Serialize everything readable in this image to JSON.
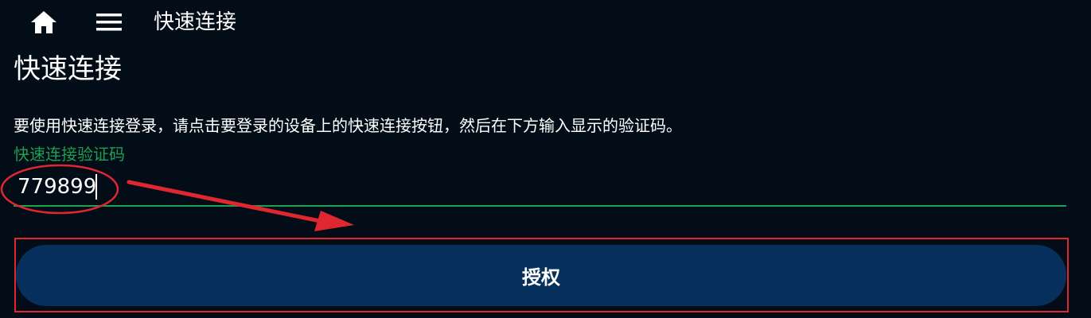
{
  "topbar": {
    "home_icon": "home-icon",
    "menu_icon": "hamburger-menu-icon",
    "title": "快速连接"
  },
  "main": {
    "title": "快速连接",
    "instructions": "要使用快速连接登录，请点击要登录的设备上的快速连接按钮，然后在下方输入显示的验证码。",
    "code_field": {
      "label": "快速连接验证码",
      "value": "779899"
    },
    "authorize_button": "授权"
  },
  "colors": {
    "background": "#020d18",
    "accent_green": "#1e9f52",
    "button_bg": "#07305c",
    "annotation_red": "#e0262f"
  }
}
